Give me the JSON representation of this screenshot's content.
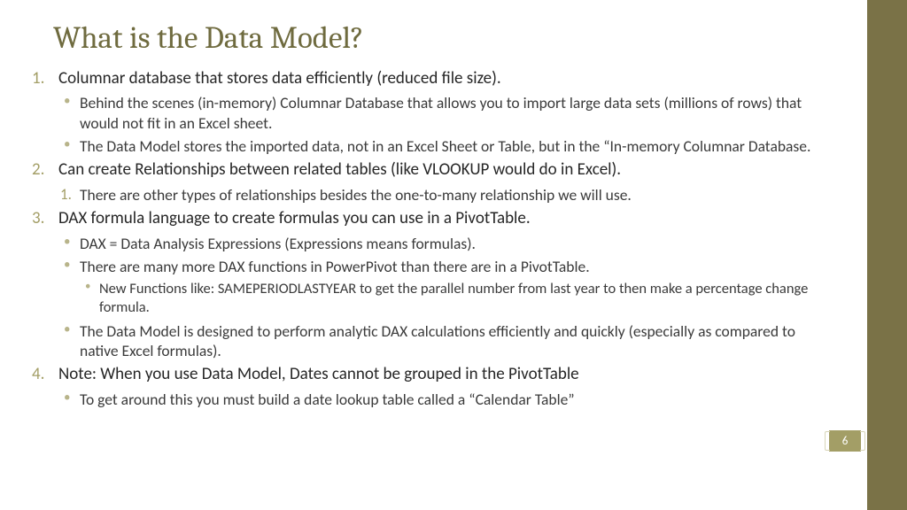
{
  "title": "What is the Data Model?",
  "pageNumber": "6",
  "items": [
    {
      "text": "Columnar database that stores data efficiently (reduced file size).",
      "sub": [
        {
          "type": "bullet",
          "text": "Behind the scenes (in-memory) Columnar Database that allows you to import large data sets (millions of rows) that would not fit in an Excel sheet."
        },
        {
          "type": "bullet",
          "text": "The Data Model stores the imported data, not in an Excel Sheet or Table, but in the “In-memory Columnar Database."
        }
      ]
    },
    {
      "text": "Can create Relationships between related tables (like VLOOKUP would do in Excel).",
      "subNumbered": true,
      "sub": [
        {
          "type": "num",
          "text": "There are other types of relationships besides the one-to-many relationship we will use."
        }
      ]
    },
    {
      "text": "DAX formula language to create formulas you can use in a PivotTable.",
      "sub": [
        {
          "type": "bullet",
          "text": "DAX = Data Analysis Expressions (Expressions means formulas)."
        },
        {
          "type": "bullet",
          "text": "There are many more DAX functions in PowerPivot than there are in a PivotTable.",
          "sub": [
            {
              "text": "New Functions like: SAMEPERIODLASTYEAR to get the parallel number from last year to then make a percentage change formula."
            }
          ]
        },
        {
          "type": "bullet",
          "text": " The Data Model is designed to perform analytic DAX calculations efficiently and quickly (especially as compared to native Excel formulas)."
        }
      ]
    },
    {
      "text": "Note: When you use Data Model, Dates cannot be grouped in the PivotTable",
      "sub": [
        {
          "type": "bullet",
          "text": "To get around this you must build a date lookup table called a “Calendar Table”"
        }
      ]
    }
  ]
}
